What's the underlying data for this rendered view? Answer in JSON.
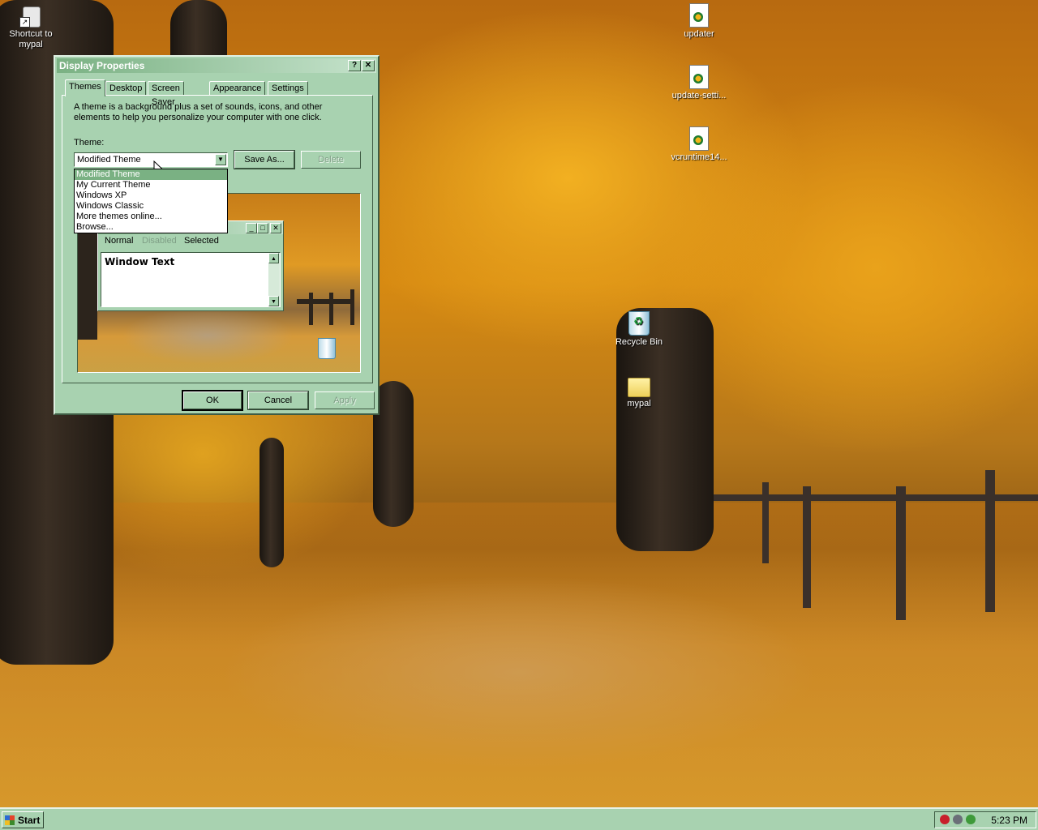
{
  "desktop": {
    "icons": [
      {
        "label": "Shortcut to mypal"
      },
      {
        "label": "updater"
      },
      {
        "label": "update-setti..."
      },
      {
        "label": "vcruntime14..."
      },
      {
        "label": "Recycle Bin"
      },
      {
        "label": "mypal"
      }
    ]
  },
  "dialog": {
    "title": "Display Properties",
    "help_button": "?",
    "close_button": "✕",
    "tabs": [
      "Themes",
      "Desktop",
      "Screen Saver",
      "Appearance",
      "Settings"
    ],
    "active_tab": "Themes",
    "description": "A theme is a background plus a set of sounds, icons, and other elements to help you personalize your computer with one click.",
    "theme_label": "Theme:",
    "theme_value": "Modified Theme",
    "save_as_label": "Save As...",
    "delete_label": "Delete",
    "dropdown_options": [
      "Modified Theme",
      "My Current Theme",
      "Windows XP",
      "Windows Classic",
      "More themes online...",
      "Browse..."
    ],
    "preview": {
      "menu": [
        "Normal",
        "Disabled",
        "Selected"
      ],
      "window_text": "Window Text"
    },
    "ok_label": "OK",
    "cancel_label": "Cancel",
    "apply_label": "Apply"
  },
  "taskbar": {
    "start_label": "Start",
    "clock": "5:23 PM"
  },
  "colors": {
    "window_face": "#a8d2b0",
    "title_gradient_start": "#7ab183",
    "title_gradient_end": "#c6e3cc"
  }
}
